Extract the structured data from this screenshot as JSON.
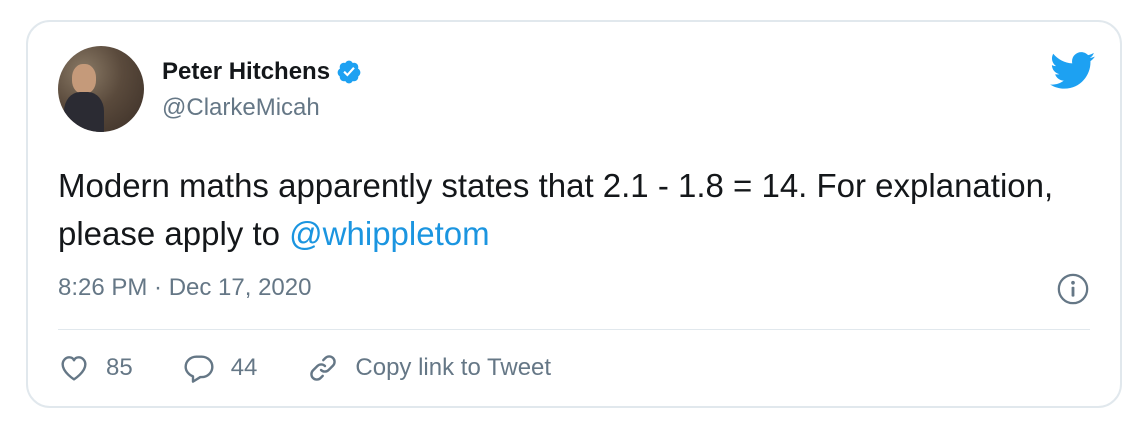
{
  "author": {
    "display_name": "Peter Hitchens",
    "handle": "@ClarkeMicah",
    "verified": true,
    "avatar_icon": "profile-photo"
  },
  "tweet": {
    "text_before_mention": "Modern maths apparently states that 2.1 - 1.8 = 14. For explanation, please apply to ",
    "mention": "@whippletom",
    "timestamp": "8:26 PM · Dec 17, 2020"
  },
  "actions": {
    "likes_count": "85",
    "replies_count": "44",
    "copy_link_label": "Copy link to Tweet"
  },
  "icons": {
    "brand": "twitter-bird-icon",
    "verified": "verified-badge-icon",
    "info": "info-icon",
    "like": "heart-icon",
    "reply": "reply-bubble-icon",
    "link": "link-icon"
  },
  "colors": {
    "brand_blue": "#1da1f2",
    "link_blue": "#1b95e0",
    "secondary_text": "#657786",
    "primary_text": "#14171a",
    "border": "#e1e8ed"
  }
}
